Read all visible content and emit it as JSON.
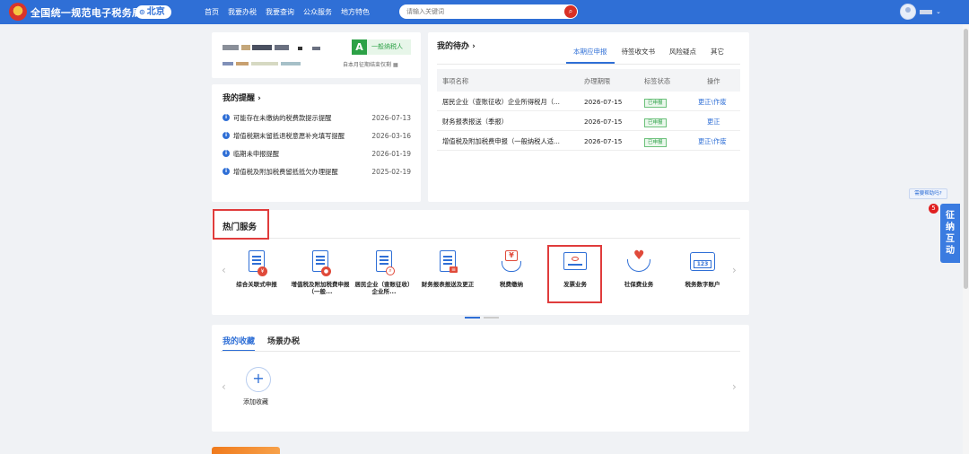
{
  "header": {
    "site_title": "全国统一规范电子税务局",
    "city": "北京",
    "nav": [
      "首页",
      "我要办税",
      "我要查询",
      "公众服务",
      "地方特色"
    ],
    "search_placeholder": "请输入关键词"
  },
  "profile": {
    "taxpayer_letter": "A",
    "taxpayer_type": "一般纳税人",
    "note": "自本月征期结束仅剩"
  },
  "reminders": {
    "title": "我的提醒 ›",
    "items": [
      {
        "text": "可能存在未缴纳的税费款提示提醒",
        "date": "2026-07-13"
      },
      {
        "text": "增值税期末留抵退税意愿补充填写提醒",
        "date": "2026-03-16"
      },
      {
        "text": "临期未申报提醒",
        "date": "2026-01-19"
      },
      {
        "text": "增值税及附加税费留抵抵欠办理提醒",
        "date": "2025-02-19"
      }
    ]
  },
  "todo": {
    "title": "我的待办 ›",
    "tabs": [
      "本期应申报",
      "待签收文书",
      "风险疑点",
      "其它"
    ],
    "columns": [
      "事项名称",
      "办理期限",
      "标签状态",
      "操作"
    ],
    "rows": [
      {
        "name": "居民企业（查账征收）企业所得税月（...",
        "deadline": "2026-07-15",
        "status": "已申报",
        "action": "更正\\作废"
      },
      {
        "name": "财务报表报送（季报）",
        "deadline": "2026-07-15",
        "status": "已申报",
        "action": "更正"
      },
      {
        "name": "增值税及附加税费申报（一般纳税人适...",
        "deadline": "2026-07-15",
        "status": "已申报",
        "action": "更正\\作废"
      }
    ]
  },
  "hot_services": {
    "title": "热门服务",
    "items": [
      {
        "label": "综合关联式申报",
        "icon": "comprehensive-declaration-icon"
      },
      {
        "label": "增值税及附加税费申报（一般...",
        "icon": "vat-declaration-icon"
      },
      {
        "label": "居民企业（查账征收）企业所...",
        "icon": "corporate-income-tax-icon"
      },
      {
        "label": "财务报表报送及更正",
        "icon": "financial-statement-icon"
      },
      {
        "label": "税费缴纳",
        "icon": "tax-payment-icon"
      },
      {
        "label": "发票业务",
        "icon": "invoice-icon"
      },
      {
        "label": "社保费业务",
        "icon": "social-security-icon"
      },
      {
        "label": "税务数字账户",
        "icon": "digital-account-icon"
      }
    ]
  },
  "favorites": {
    "tabs": [
      "我的收藏",
      "场景办税"
    ],
    "add_label": "添加收藏"
  },
  "floating": {
    "help_tip": "需要帮助吗?",
    "badge_count": "5",
    "interact_label": [
      "征",
      "纳",
      "互",
      "动"
    ]
  }
}
